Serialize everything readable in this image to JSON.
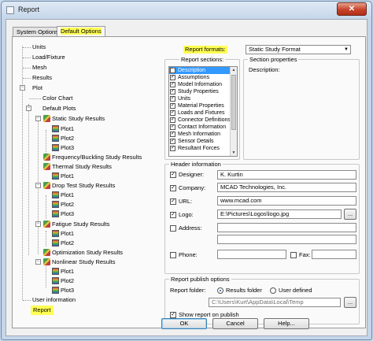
{
  "window": {
    "title": "Report",
    "close": "✕"
  },
  "tabs": [
    {
      "label": "System Options",
      "selected": false
    },
    {
      "label": "Default Options",
      "selected": true
    }
  ],
  "tree": {
    "items": {
      "units": "Units",
      "load_fixture": "Load/Fixture",
      "mesh": "Mesh",
      "results": "Results",
      "plot": "Plot",
      "color_chart": "Color Chart",
      "default_plots": "Default Plots",
      "static_study": "Static Study Results",
      "freq_study": "Frequency/Buckling Study Results",
      "thermal_study": "Thermal Study Results",
      "drop_test_study": "Drop Test Study Results",
      "fatigue_study": "Fatigue Study Results",
      "optimization_study": "Optimization Study Results",
      "nonlinear_study": "Nonlinear Study Results",
      "user_information": "User information",
      "report": "Report",
      "plot1": "Plot1",
      "plot2": "Plot2",
      "plot3": "Plot3"
    }
  },
  "report_formats": {
    "label": "Report formats:",
    "value": "Static Study Format"
  },
  "report_sections": {
    "label": "Report sections:",
    "items": [
      {
        "label": "Description",
        "checked": true,
        "selected": true
      },
      {
        "label": "Assumptions",
        "checked": true
      },
      {
        "label": "Model Information",
        "checked": true
      },
      {
        "label": "Study Properties",
        "checked": true
      },
      {
        "label": "Units",
        "checked": true
      },
      {
        "label": "Material Properties",
        "checked": true
      },
      {
        "label": "Loads and Fixtures",
        "checked": true
      },
      {
        "label": "Connector Definitions",
        "checked": true
      },
      {
        "label": "Contact Information",
        "checked": true
      },
      {
        "label": "Mesh Information",
        "checked": true
      },
      {
        "label": "Sensor Details",
        "checked": true
      },
      {
        "label": "Resultant Forces",
        "checked": true
      }
    ]
  },
  "section_properties": {
    "label": "Section properties",
    "description_label": "Description:"
  },
  "header_information": {
    "label": "Header information",
    "designer": {
      "label": "Designer:",
      "value": "K. Kurtin",
      "checked": true
    },
    "company": {
      "label": "Company:",
      "value": "MCAD Technologies, Inc.",
      "checked": true
    },
    "url": {
      "label": "URL:",
      "value": "www.mcad.com",
      "checked": true
    },
    "logo": {
      "label": "Logo:",
      "value": "E:\\Pictures\\Logos\\logo.jpg",
      "checked": true,
      "browse": "..."
    },
    "address": {
      "label": "Address:",
      "value": "",
      "checked": false
    },
    "phone": {
      "label": "Phone:",
      "value": "",
      "checked": false
    },
    "fax": {
      "label": "Fax:",
      "value": "",
      "checked": false
    }
  },
  "publish_options": {
    "label": "Report publish options",
    "folder_label": "Report folder:",
    "radio_results": "Results folder",
    "radio_user": "User defined",
    "path": "C:\\Users\\Kurt\\AppData\\Local\\Temp",
    "browse": "...",
    "show_on_publish": "Show report on publish"
  },
  "buttons": {
    "ok": "OK",
    "cancel": "Cancel",
    "help": "Help..."
  },
  "check_mark": "✓",
  "minus": "−"
}
